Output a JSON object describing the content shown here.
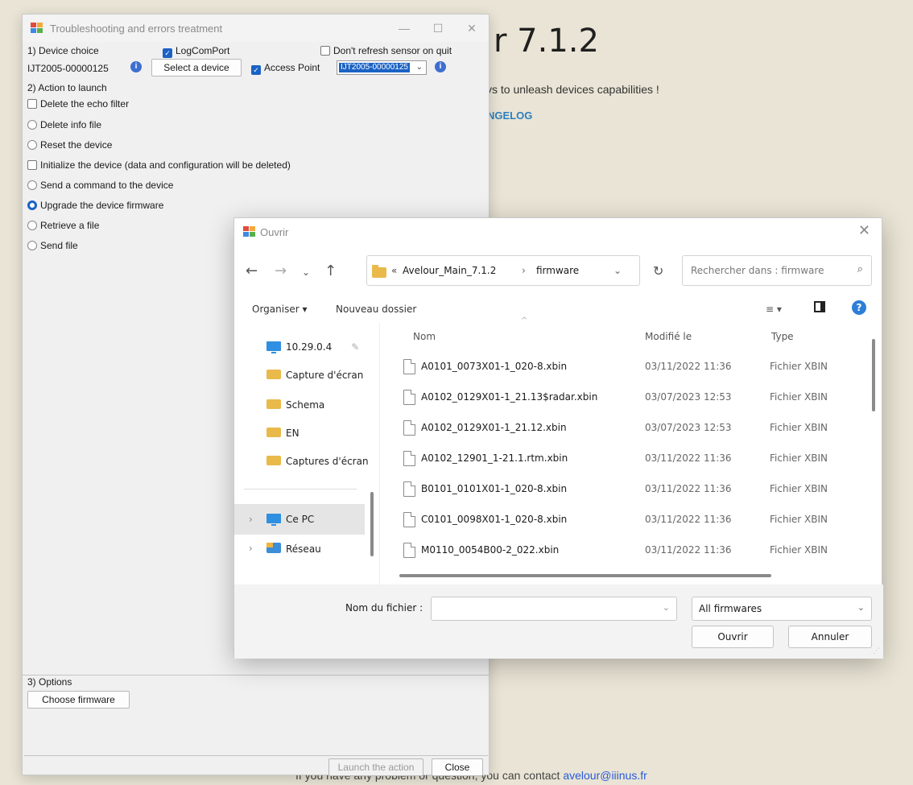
{
  "background": {
    "title": "r 7.1.2",
    "subtitle": "vs to unleash devices capabilities !",
    "link": "NGELOG",
    "footer_text": "If you have any problem or question, you can contact ",
    "footer_email": "avelour@iiinus.fr"
  },
  "main_window": {
    "title": "Troubleshooting and errors treatment",
    "controls": [
      "—",
      "☐",
      "✕"
    ],
    "section1_label": "1) Device choice",
    "logcomport_label": "LogComPort",
    "dont_refresh_label": "Don't refresh sensor on quit",
    "device_id": "IJT2005-00000125",
    "select_device_button": "Select a device",
    "access_point_label": "Access Point",
    "access_point_value": "IJT2005-00000125",
    "section2_label": "2) Action to launch",
    "actions": [
      {
        "label": "Delete the echo filter",
        "type": "checkbox",
        "checked": false
      },
      {
        "label": "Delete info file",
        "type": "radio",
        "checked": false
      },
      {
        "label": "Reset the device",
        "type": "radio",
        "checked": false
      },
      {
        "label": "Initialize the device (data and configuration will be deleted)",
        "type": "checkbox",
        "checked": false
      },
      {
        "label": "Send a command to the device",
        "type": "radio",
        "checked": false
      },
      {
        "label": "Upgrade the device firmware",
        "type": "radio",
        "checked": true
      },
      {
        "label": "Retrieve a file",
        "type": "radio",
        "checked": false
      },
      {
        "label": "Send file",
        "type": "radio",
        "checked": false
      }
    ],
    "section3_label": "3) Options",
    "choose_firmware_button": "Choose firmware",
    "launch_button": "Launch the action",
    "close_button": "Close"
  },
  "dialog": {
    "title": "Ouvrir",
    "path_prefix": "«",
    "path_parts": [
      "Avelour_Main_7.1.2",
      "firmware"
    ],
    "path_sep": "›",
    "search_placeholder": "Rechercher dans : firmware",
    "organiser_label": "Organiser ▾",
    "new_folder_label": "Nouveau dossier",
    "nav_items": [
      {
        "label": "10.29.0.4",
        "icon": "pc-icon"
      },
      {
        "label": "Capture d'écran",
        "icon": "folder-icon"
      },
      {
        "label": "Schema",
        "icon": "folder-icon"
      },
      {
        "label": "EN",
        "icon": "folder-icon"
      },
      {
        "label": "Captures d'écran",
        "icon": "folder-icon"
      }
    ],
    "nav_this_pc": "Ce PC",
    "nav_network": "Réseau",
    "columns": [
      "Nom",
      "Modifié le",
      "Type"
    ],
    "files": [
      {
        "name": "A0101_0073X01-1_020-8.xbin",
        "date": "03/11/2022 11:36",
        "type": "Fichier XBIN"
      },
      {
        "name": "A0102_0129X01-1_21.13$radar.xbin",
        "date": "03/07/2023 12:53",
        "type": "Fichier XBIN"
      },
      {
        "name": "A0102_0129X01-1_21.12.xbin",
        "date": "03/07/2023 12:53",
        "type": "Fichier XBIN"
      },
      {
        "name": "A0102_12901_1-21.1.rtm.xbin",
        "date": "03/11/2022 11:36",
        "type": "Fichier XBIN"
      },
      {
        "name": "B0101_0101X01-1_020-8.xbin",
        "date": "03/11/2022 11:36",
        "type": "Fichier XBIN"
      },
      {
        "name": "C0101_0098X01-1_020-8.xbin",
        "date": "03/11/2022 11:36",
        "type": "Fichier XBIN"
      },
      {
        "name": "M0110_0054B00-2_022.xbin",
        "date": "03/11/2022 11:36",
        "type": "Fichier XBIN"
      }
    ],
    "filename_label": "Nom du fichier :",
    "filename_value": "",
    "filter_value": "All firmwares",
    "open_button": "Ouvrir",
    "cancel_button": "Annuler"
  },
  "colors": {
    "accent": "#1a62c4",
    "link": "#2c7fbf",
    "background": "#e9e4d5"
  }
}
